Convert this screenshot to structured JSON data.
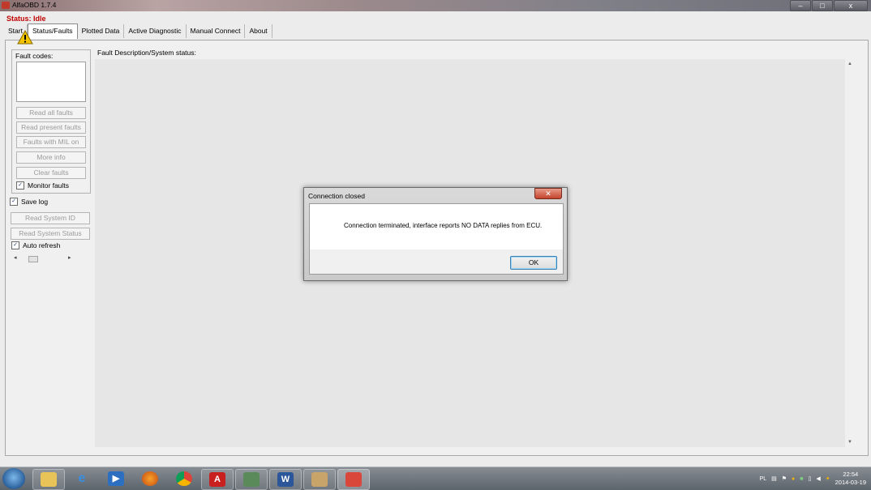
{
  "window": {
    "title": "AlfaOBD 1.7.4",
    "controls": {
      "minimize": "–",
      "maximize": "□",
      "close": "x"
    }
  },
  "status": "Status: Idle",
  "tabs": [
    "Start",
    "Status/Faults",
    "Plotted Data",
    "Active Diagnostic",
    "Manual Connect",
    "About"
  ],
  "active_tab": "Status/Faults",
  "fault_panel": {
    "group_label": "Fault codes:",
    "buttons": {
      "read_all": "Read all faults",
      "read_present": "Read present faults",
      "faults_mil": "Faults with MIL on",
      "more_info": "More info",
      "clear": "Clear faults"
    },
    "monitor_faults": "Monitor faults",
    "save_log": "Save log",
    "read_system_id": "Read System ID",
    "read_system_status": "Read System Status",
    "auto_refresh": "Auto refresh"
  },
  "description": {
    "label": "Fault Description/System status:"
  },
  "dialog": {
    "title": "Connection closed",
    "message": "Connection terminated, interface reports NO DATA replies from ECU.",
    "ok": "OK"
  },
  "taskbar": {
    "apps": [
      "start-orb",
      "file-explorer-icon",
      "internet-explorer-icon",
      "media-player-icon",
      "firefox-icon",
      "chrome-icon",
      "acrobat-icon",
      "network-app-icon",
      "word-icon",
      "paint-icon",
      "alfaobd-icon"
    ],
    "tray_lang": "PL",
    "time": "22:54",
    "date": "2014-03-19"
  }
}
